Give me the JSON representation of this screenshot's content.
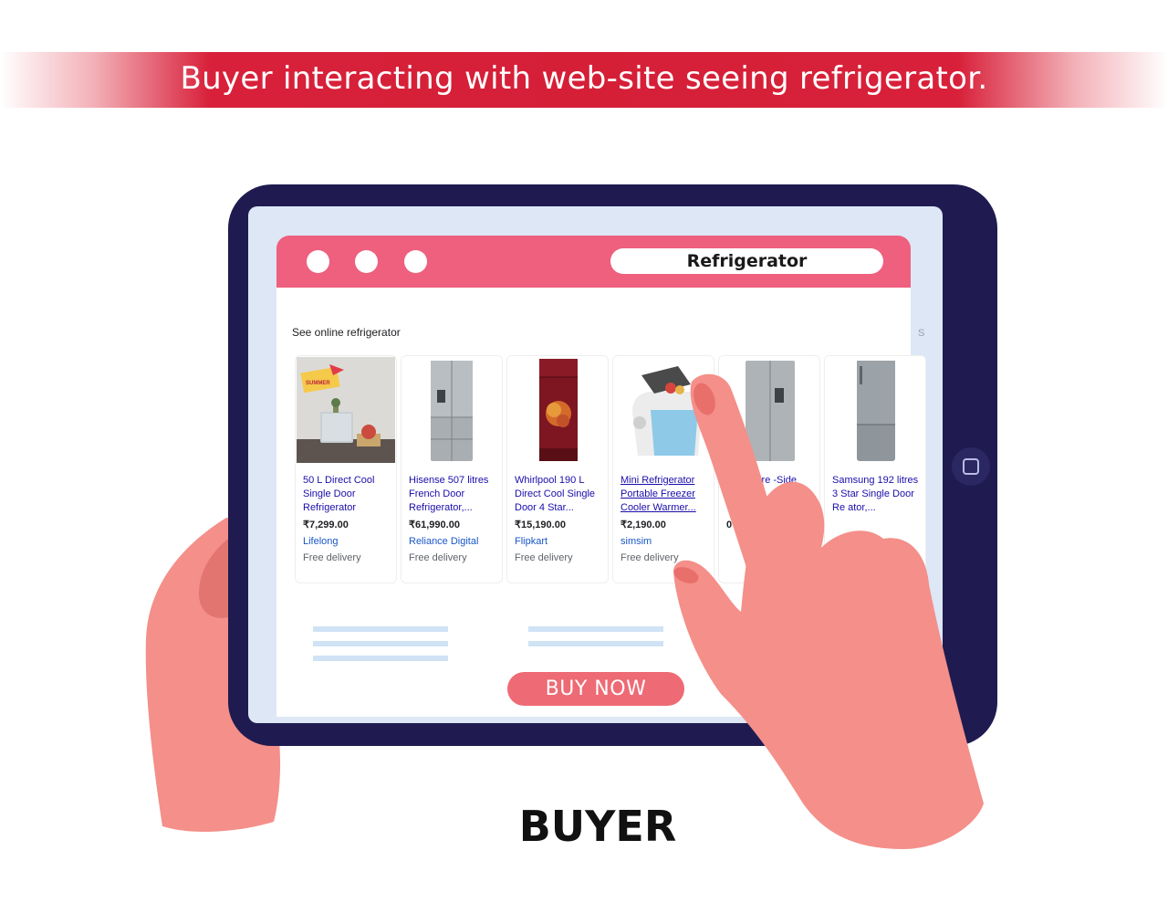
{
  "banner": {
    "text": "Buyer interacting with web-site seeing refrigerator."
  },
  "browser": {
    "address_text": "Refrigerator",
    "section_title": "See online refrigerator",
    "cut_letter": "S"
  },
  "products": [
    {
      "name": "50 L Direct Cool Single Door Refrigerator",
      "price": "₹7,299.00",
      "store": "Lifelong",
      "delivery": "Free delivery",
      "badge_text": "SUMMER"
    },
    {
      "name": "Hisense 507 litres French Door Refrigerator,...",
      "price": "₹61,990.00",
      "store": "Reliance Digital",
      "delivery": "Free delivery"
    },
    {
      "name": "Whirlpool 190 L Direct Cool Single Door 4 Star...",
      "price": "₹15,190.00",
      "store": "Flipkart",
      "delivery": "Free delivery"
    },
    {
      "name": "Mini Refrigerator Portable Freezer Cooler Warmer...",
      "price": "₹2,190.00",
      "store": "simsim",
      "delivery": "Free delivery"
    },
    {
      "name": "e 566 litre -Side ator,...",
      "price": "0",
      "store": "",
      "delivery": ""
    },
    {
      "name": "Samsung 192 litres 3 Star Single Door Re ator,...",
      "price": "",
      "store": "",
      "delivery": ""
    }
  ],
  "buy_button": {
    "label": "BUY NOW"
  },
  "footer_label": "BUYER",
  "colors": {
    "banner": "#d51f37",
    "tablet": "#1f1b50",
    "browser_bar": "#ee607e",
    "buy_button": "#ee6a74",
    "hand": "#f48f8a"
  }
}
